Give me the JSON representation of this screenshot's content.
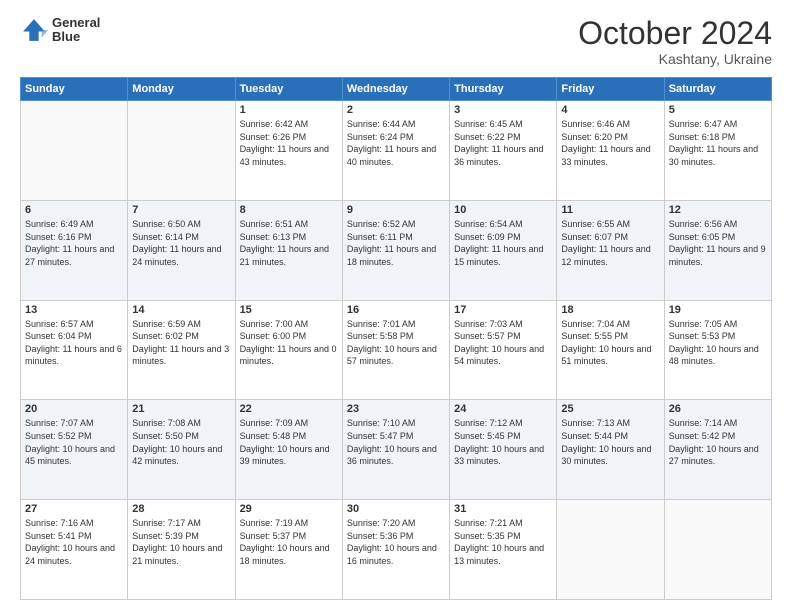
{
  "header": {
    "logo_line1": "General",
    "logo_line2": "Blue",
    "month": "October 2024",
    "location": "Kashtany, Ukraine"
  },
  "weekdays": [
    "Sunday",
    "Monday",
    "Tuesday",
    "Wednesday",
    "Thursday",
    "Friday",
    "Saturday"
  ],
  "weeks": [
    [
      {
        "day": "",
        "info": ""
      },
      {
        "day": "",
        "info": ""
      },
      {
        "day": "1",
        "info": "Sunrise: 6:42 AM\nSunset: 6:26 PM\nDaylight: 11 hours and 43 minutes."
      },
      {
        "day": "2",
        "info": "Sunrise: 6:44 AM\nSunset: 6:24 PM\nDaylight: 11 hours and 40 minutes."
      },
      {
        "day": "3",
        "info": "Sunrise: 6:45 AM\nSunset: 6:22 PM\nDaylight: 11 hours and 36 minutes."
      },
      {
        "day": "4",
        "info": "Sunrise: 6:46 AM\nSunset: 6:20 PM\nDaylight: 11 hours and 33 minutes."
      },
      {
        "day": "5",
        "info": "Sunrise: 6:47 AM\nSunset: 6:18 PM\nDaylight: 11 hours and 30 minutes."
      }
    ],
    [
      {
        "day": "6",
        "info": "Sunrise: 6:49 AM\nSunset: 6:16 PM\nDaylight: 11 hours and 27 minutes."
      },
      {
        "day": "7",
        "info": "Sunrise: 6:50 AM\nSunset: 6:14 PM\nDaylight: 11 hours and 24 minutes."
      },
      {
        "day": "8",
        "info": "Sunrise: 6:51 AM\nSunset: 6:13 PM\nDaylight: 11 hours and 21 minutes."
      },
      {
        "day": "9",
        "info": "Sunrise: 6:52 AM\nSunset: 6:11 PM\nDaylight: 11 hours and 18 minutes."
      },
      {
        "day": "10",
        "info": "Sunrise: 6:54 AM\nSunset: 6:09 PM\nDaylight: 11 hours and 15 minutes."
      },
      {
        "day": "11",
        "info": "Sunrise: 6:55 AM\nSunset: 6:07 PM\nDaylight: 11 hours and 12 minutes."
      },
      {
        "day": "12",
        "info": "Sunrise: 6:56 AM\nSunset: 6:05 PM\nDaylight: 11 hours and 9 minutes."
      }
    ],
    [
      {
        "day": "13",
        "info": "Sunrise: 6:57 AM\nSunset: 6:04 PM\nDaylight: 11 hours and 6 minutes."
      },
      {
        "day": "14",
        "info": "Sunrise: 6:59 AM\nSunset: 6:02 PM\nDaylight: 11 hours and 3 minutes."
      },
      {
        "day": "15",
        "info": "Sunrise: 7:00 AM\nSunset: 6:00 PM\nDaylight: 11 hours and 0 minutes."
      },
      {
        "day": "16",
        "info": "Sunrise: 7:01 AM\nSunset: 5:58 PM\nDaylight: 10 hours and 57 minutes."
      },
      {
        "day": "17",
        "info": "Sunrise: 7:03 AM\nSunset: 5:57 PM\nDaylight: 10 hours and 54 minutes."
      },
      {
        "day": "18",
        "info": "Sunrise: 7:04 AM\nSunset: 5:55 PM\nDaylight: 10 hours and 51 minutes."
      },
      {
        "day": "19",
        "info": "Sunrise: 7:05 AM\nSunset: 5:53 PM\nDaylight: 10 hours and 48 minutes."
      }
    ],
    [
      {
        "day": "20",
        "info": "Sunrise: 7:07 AM\nSunset: 5:52 PM\nDaylight: 10 hours and 45 minutes."
      },
      {
        "day": "21",
        "info": "Sunrise: 7:08 AM\nSunset: 5:50 PM\nDaylight: 10 hours and 42 minutes."
      },
      {
        "day": "22",
        "info": "Sunrise: 7:09 AM\nSunset: 5:48 PM\nDaylight: 10 hours and 39 minutes."
      },
      {
        "day": "23",
        "info": "Sunrise: 7:10 AM\nSunset: 5:47 PM\nDaylight: 10 hours and 36 minutes."
      },
      {
        "day": "24",
        "info": "Sunrise: 7:12 AM\nSunset: 5:45 PM\nDaylight: 10 hours and 33 minutes."
      },
      {
        "day": "25",
        "info": "Sunrise: 7:13 AM\nSunset: 5:44 PM\nDaylight: 10 hours and 30 minutes."
      },
      {
        "day": "26",
        "info": "Sunrise: 7:14 AM\nSunset: 5:42 PM\nDaylight: 10 hours and 27 minutes."
      }
    ],
    [
      {
        "day": "27",
        "info": "Sunrise: 7:16 AM\nSunset: 5:41 PM\nDaylight: 10 hours and 24 minutes."
      },
      {
        "day": "28",
        "info": "Sunrise: 7:17 AM\nSunset: 5:39 PM\nDaylight: 10 hours and 21 minutes."
      },
      {
        "day": "29",
        "info": "Sunrise: 7:19 AM\nSunset: 5:37 PM\nDaylight: 10 hours and 18 minutes."
      },
      {
        "day": "30",
        "info": "Sunrise: 7:20 AM\nSunset: 5:36 PM\nDaylight: 10 hours and 16 minutes."
      },
      {
        "day": "31",
        "info": "Sunrise: 7:21 AM\nSunset: 5:35 PM\nDaylight: 10 hours and 13 minutes."
      },
      {
        "day": "",
        "info": ""
      },
      {
        "day": "",
        "info": ""
      }
    ]
  ]
}
